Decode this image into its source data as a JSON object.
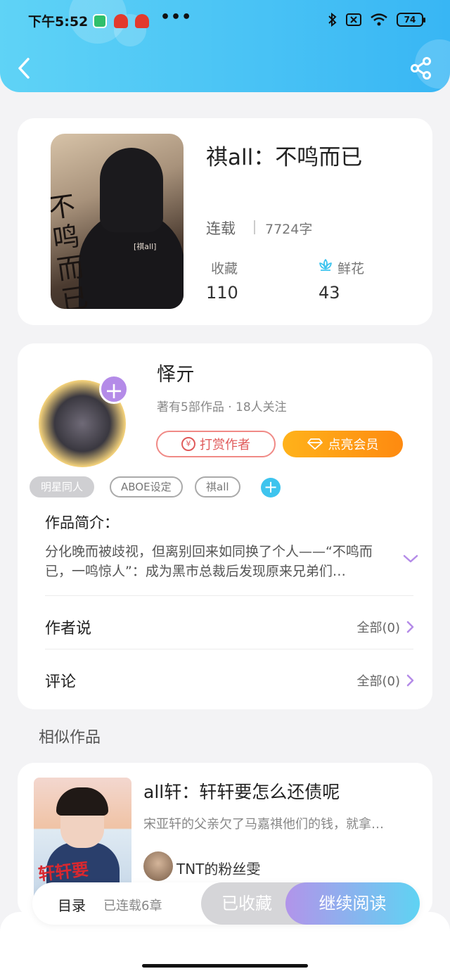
{
  "status_bar": {
    "time": "下午5:52",
    "more": "•••",
    "battery": "74"
  },
  "book": {
    "title": "祺all：不鸣而已",
    "status": "连载",
    "word_count": "7724字",
    "favorites_label": "收藏",
    "favorites_value": "110",
    "flowers_label": "鲜花",
    "flowers_value": "43",
    "cover_text": "不鸣而已",
    "cover_tag": "[祺all]"
  },
  "author": {
    "name": "怿亓",
    "meta": "著有5部作品 · 18人关注",
    "tip_button": "打赏作者",
    "vip_button": "点亮会员",
    "follow_plus": "+",
    "coin_symbol": "¥"
  },
  "tags": [
    {
      "label": "明星同人",
      "active": true
    },
    {
      "label": "ABOE设定",
      "active": false
    },
    {
      "label": "祺all",
      "active": false
    }
  ],
  "tag_add": "+",
  "intro": {
    "label": "作品简介：",
    "text": "分化晚而被歧视，但离别回来如同换了个人——“不鸣而已，一鸣惊人”：成为黑市总裁后发现原来兄弟们…"
  },
  "author_says": {
    "label": "作者说",
    "right": "全部(0)"
  },
  "comments": {
    "label": "评论",
    "right": "全部(0)"
  },
  "similar": {
    "section_label": "相似作品",
    "items": [
      {
        "title": "all轩：轩轩要怎么还债呢",
        "desc": "宋亚轩的父亲欠了马嘉祺他们的钱，就拿…",
        "author": "TNT的粉丝雯",
        "cover_text": "轩轩要"
      }
    ]
  },
  "bottom_bar": {
    "toc": "目录",
    "chapters": "已连载6章",
    "favorited": "已收藏",
    "continue": "继续阅读"
  },
  "colors": {
    "header": "#38b6f4",
    "accent_purple": "#b48be8",
    "tip_red": "#e05a5a",
    "vip_orange": "#fe8a10"
  }
}
